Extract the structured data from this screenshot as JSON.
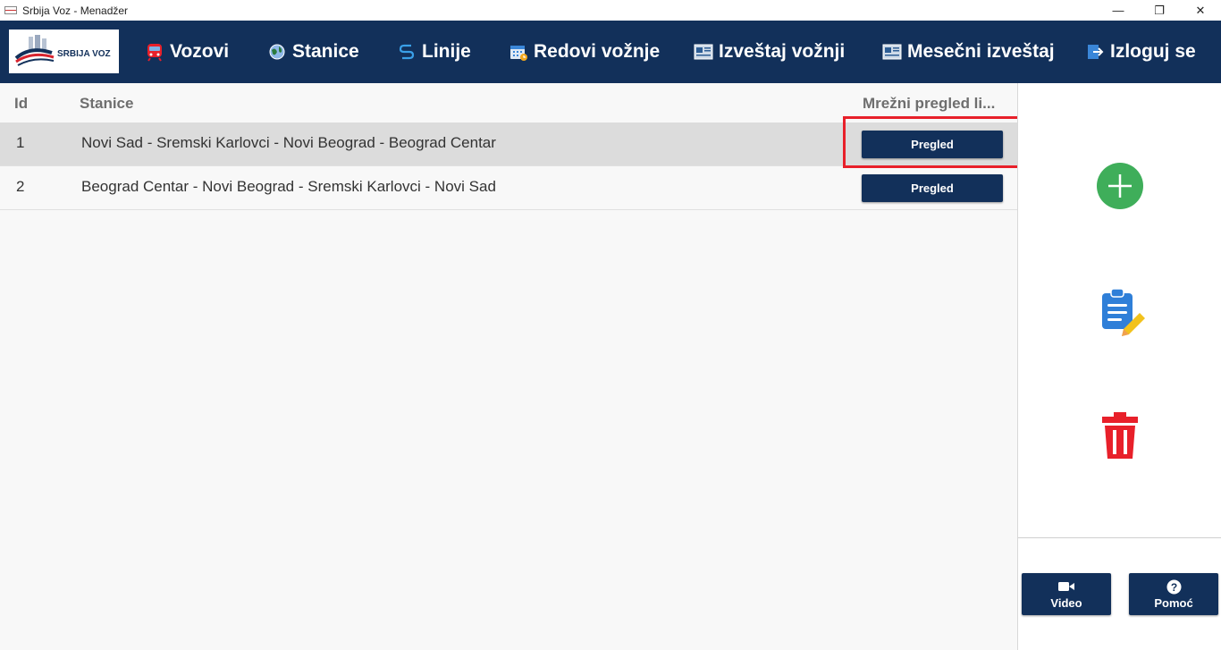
{
  "window": {
    "title": "Srbija Voz - Menadžer",
    "minimize": "—",
    "restore": "❐",
    "close": "✕"
  },
  "logo": {
    "text": "SRBIJA VOZ"
  },
  "nav": {
    "vozovi": "Vozovi",
    "stanice": "Stanice",
    "linije": "Linije",
    "redovi": "Redovi vožnje",
    "izvestaj": "Izveštaj vožnji",
    "mesecni": "Mesečni izveštaj",
    "izloguj": "Izloguj se"
  },
  "table": {
    "headers": {
      "id": "Id",
      "stanice": "Stanice",
      "mrezni": "Mrežni pregled li..."
    },
    "rows": [
      {
        "id": "1",
        "stanice": "Novi Sad - Sremski Karlovci - Novi Beograd - Beograd Centar",
        "button": "Pregled"
      },
      {
        "id": "2",
        "stanice": "Beograd Centar - Novi Beograd - Sremski Karlovci - Novi Sad",
        "button": "Pregled"
      }
    ]
  },
  "panel": {
    "video": "Video",
    "pomoc": "Pomoć"
  },
  "colors": {
    "navy": "#12305a",
    "add": "#3fae5a",
    "delete": "#e8202a",
    "highlight": "#e8202a"
  }
}
